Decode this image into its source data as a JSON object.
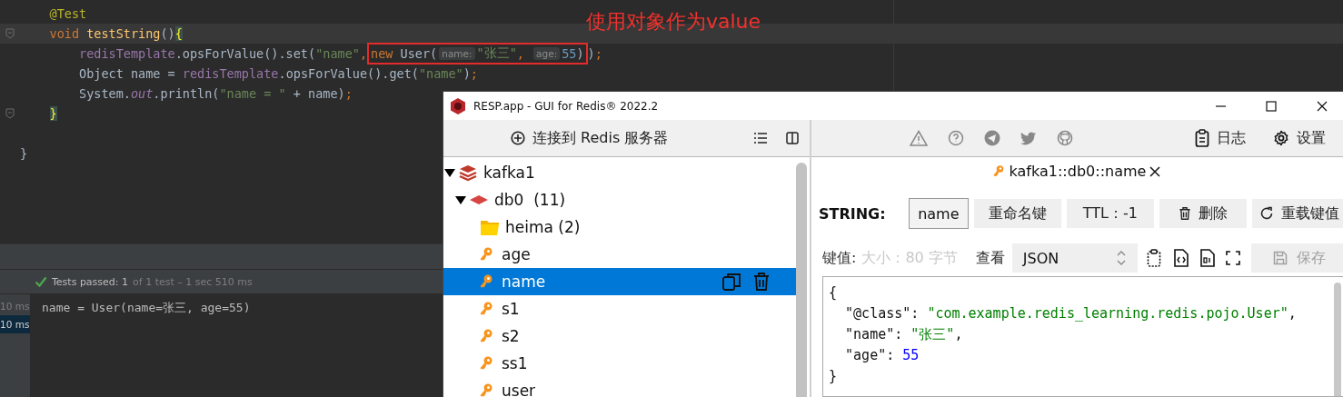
{
  "editor": {
    "annotation": "使用对象作为value",
    "lines": [
      {
        "fold": false,
        "current": false,
        "tokens": [
          {
            "kind": "annotation",
            "text": "    @Test"
          }
        ]
      },
      {
        "fold": true,
        "current": true,
        "tokens": [
          {
            "kind": "keyword",
            "text": "    void "
          },
          {
            "kind": "method",
            "text": "testString"
          },
          {
            "kind": "plain",
            "text": "()"
          },
          {
            "kind": "brace",
            "text": "{"
          }
        ]
      },
      {
        "fold": false,
        "current": false,
        "tokens": [
          {
            "kind": "field",
            "text": "        redisTemplate"
          },
          {
            "kind": "plain",
            "text": ".opsForValue().set("
          },
          {
            "kind": "string",
            "text": "\"name\""
          },
          {
            "kind": "punct",
            "text": ","
          },
          {
            "kind": "box",
            "tokens": [
              {
                "kind": "keyword",
                "text": "new"
              },
              {
                "kind": "plain",
                "text": " User("
              },
              {
                "kind": "hint",
                "text": "name:"
              },
              {
                "kind": "string",
                "text": "\"张三\""
              },
              {
                "kind": "punct",
                "text": ", "
              },
              {
                "kind": "hint",
                "text": "age:"
              },
              {
                "kind": "number",
                "text": "55"
              },
              {
                "kind": "plain",
                "text": ")"
              }
            ]
          },
          {
            "kind": "plain",
            "text": ")"
          },
          {
            "kind": "punct",
            "text": ";"
          }
        ]
      },
      {
        "fold": false,
        "current": false,
        "tokens": [
          {
            "kind": "plain",
            "text": "        Object name = "
          },
          {
            "kind": "field",
            "text": "redisTemplate"
          },
          {
            "kind": "plain",
            "text": ".opsForValue().get("
          },
          {
            "kind": "string",
            "text": "\"name\""
          },
          {
            "kind": "plain",
            "text": ")"
          },
          {
            "kind": "punct",
            "text": ";"
          }
        ]
      },
      {
        "fold": false,
        "current": false,
        "tokens": [
          {
            "kind": "plain",
            "text": "        System."
          },
          {
            "kind": "static",
            "text": "out"
          },
          {
            "kind": "plain",
            "text": ".println("
          },
          {
            "kind": "string",
            "text": "\"name = \""
          },
          {
            "kind": "plain",
            "text": " + name)"
          },
          {
            "kind": "punct",
            "text": ";"
          }
        ]
      },
      {
        "fold": true,
        "current": false,
        "tokens": [
          {
            "kind": "brace",
            "text": "    }"
          }
        ]
      },
      {
        "fold": false,
        "current": false
      },
      {
        "fold": false,
        "current": false,
        "tokens": [
          {
            "kind": "plain",
            "text": "}"
          }
        ]
      }
    ]
  },
  "tests": {
    "passed": true,
    "summary": "Tests passed: 1",
    "detail": "of 1 test – 1 sec 510 ms",
    "durations": [
      {
        "text": "10 ms",
        "selected": false
      },
      {
        "text": "10 ms",
        "selected": true
      }
    ]
  },
  "console": {
    "lines": [
      "name = User(name=张三, age=55)"
    ]
  },
  "resp_window": {
    "title": "RESP.app - GUI for Redis® 2022.2",
    "sidebar": {
      "connect_button": "连接到 Redis 服务器",
      "tree": [
        {
          "label": "kafka1",
          "kind": "server",
          "expanded": true,
          "selected": false,
          "children": [
            {
              "label": "db0  (11)",
              "kind": "database",
              "expanded": true,
              "selected": false,
              "children": [
                {
                  "label": "heima (2)",
                  "kind": "folder",
                  "selected": false
                },
                {
                  "label": "age",
                  "kind": "key",
                  "selected": false
                },
                {
                  "label": "name",
                  "kind": "key",
                  "selected": true
                },
                {
                  "label": "s1",
                  "kind": "key",
                  "selected": false
                },
                {
                  "label": "s2",
                  "kind": "key",
                  "selected": false
                },
                {
                  "label": "ss1",
                  "kind": "key",
                  "selected": false
                },
                {
                  "label": "user",
                  "kind": "key",
                  "selected": false
                }
              ]
            }
          ]
        }
      ]
    },
    "toolbar": {
      "buttons": [
        {
          "kind": "log",
          "label": "日志"
        },
        {
          "kind": "settings",
          "label": "设置"
        }
      ]
    },
    "tabs": [
      {
        "label": "kafka1::db0::name",
        "selected": true
      }
    ],
    "key_type": "STRING:",
    "key_actions": [
      {
        "kind": "field",
        "label": "name"
      },
      {
        "kind": "plain",
        "label": "重命名键"
      },
      {
        "kind": "plain",
        "label": "TTL：-1"
      },
      {
        "kind": "delete",
        "label": "删除"
      },
      {
        "kind": "reload",
        "label": "重载键值"
      }
    ],
    "value_label": "键值:",
    "size": "大小：80 字节",
    "view_label": "查看",
    "view_select": "JSON",
    "save_button": {
      "label": "保存",
      "disabled": true
    },
    "value_lines": [
      [
        {
          "kind": "plain",
          "text": "{"
        }
      ],
      [
        {
          "kind": "plain",
          "text": "  \"@class\": "
        },
        {
          "kind": "string",
          "text": "\"com.example.redis_learning.redis.pojo.User\""
        },
        {
          "kind": "plain",
          "text": ","
        }
      ],
      [
        {
          "kind": "plain",
          "text": "  \"name\": "
        },
        {
          "kind": "string",
          "text": "\"张三\""
        },
        {
          "kind": "plain",
          "text": ","
        }
      ],
      [
        {
          "kind": "plain",
          "text": "  \"age\": "
        },
        {
          "kind": "number",
          "text": "55"
        }
      ],
      [
        {
          "kind": "plain",
          "text": "}"
        }
      ]
    ]
  }
}
